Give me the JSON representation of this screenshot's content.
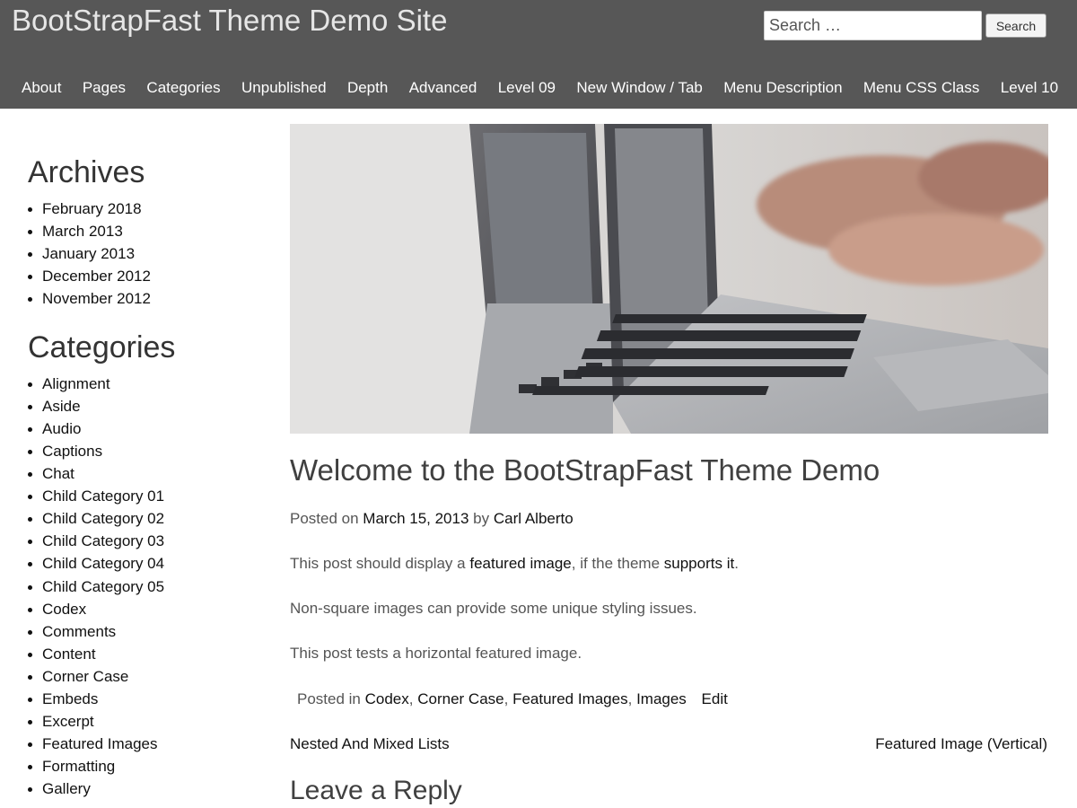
{
  "site": {
    "title": "BootStrapFast Theme Demo Site"
  },
  "search": {
    "placeholder": "Search …",
    "button_label": "Search"
  },
  "nav": {
    "items": [
      {
        "label": "About"
      },
      {
        "label": "Pages"
      },
      {
        "label": "Categories"
      },
      {
        "label": "Unpublished"
      },
      {
        "label": "Depth"
      },
      {
        "label": "Advanced"
      },
      {
        "label": "Level 09"
      },
      {
        "label": "New Window / Tab"
      },
      {
        "label": "Menu Description"
      },
      {
        "label": "Menu CSS Class"
      },
      {
        "label": "Level 10"
      }
    ]
  },
  "sidebar": {
    "archives": {
      "title": "Archives",
      "items": [
        "February 2018",
        "March 2013",
        "January 2013",
        "December 2012",
        "November 2012"
      ]
    },
    "categories": {
      "title": "Categories",
      "items": [
        "Alignment",
        "Aside",
        "Audio",
        "Captions",
        "Chat",
        "Child Category 01",
        "Child Category 02",
        "Child Category 03",
        "Child Category 04",
        "Child Category 05",
        "Codex",
        "Comments",
        "Content",
        "Corner Case",
        "Embeds",
        "Excerpt",
        "Featured Images",
        "Formatting",
        "Gallery"
      ]
    }
  },
  "post": {
    "title": "Welcome to the BootStrapFast Theme Demo",
    "meta": {
      "posted_on": "Posted on",
      "date": "March 15, 2013",
      "by": "by",
      "author": "Carl Alberto"
    },
    "para1": {
      "before": "This post should display a",
      "link1": "featured image",
      "middle": ", if the theme",
      "link2": "supports it",
      "after": "."
    },
    "para2": "Non-square images can provide some unique styling issues.",
    "para3": "This post tests a horizontal featured image.",
    "footer": {
      "posted_in": "Posted in",
      "categories": [
        "Codex",
        "Corner Case",
        "Featured Images",
        "Images"
      ],
      "separator": ",",
      "edit_label": "Edit"
    }
  },
  "post_navigation": {
    "previous": "Nested And Mixed Lists",
    "next": "Featured Image (Vertical)"
  },
  "comments": {
    "reply_title": "Leave a Reply"
  }
}
